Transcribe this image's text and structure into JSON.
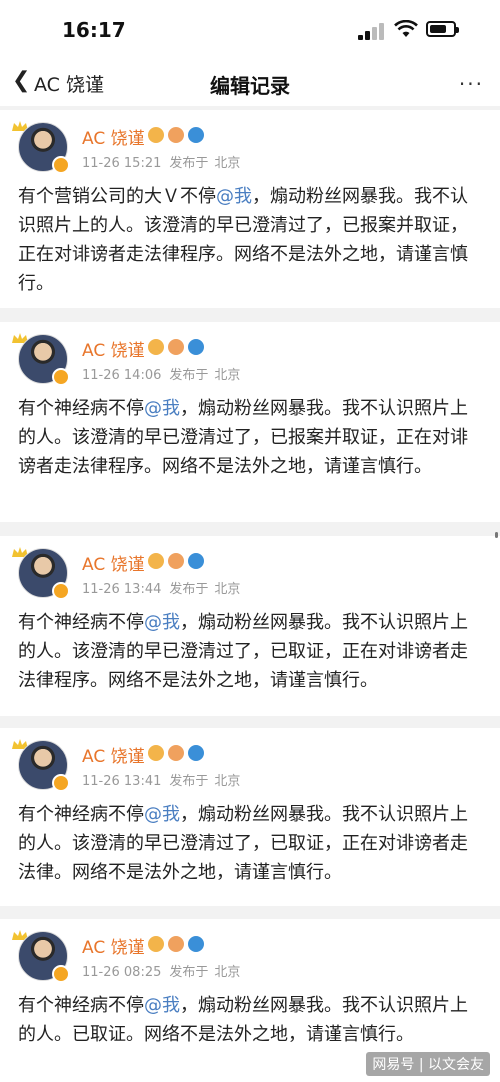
{
  "status_bar": {
    "time": "16:17"
  },
  "nav": {
    "back_label": "AC 饶谨",
    "title": "编辑记录",
    "more": "···"
  },
  "posts": [
    {
      "user": "AC 饶谨",
      "time": "11-26 15:21",
      "source": "发布于",
      "location": "北京",
      "pre": "有个营销公司的大Ｖ不停",
      "mention": "@我",
      "post": "，煽动粉丝网暴我。我不认识照片上的人。该澄清的早已澄清过了，已报案并取证，正在对诽谤者走法律程序。网络不是法外之地，请谨言慎行。"
    },
    {
      "user": "AC 饶谨",
      "time": "11-26 14:06",
      "source": "发布于",
      "location": "北京",
      "pre": "有个神经病不停",
      "mention": "@我",
      "post": "，煽动粉丝网暴我。我不认识照片上的人。该澄清的早已澄清过了，已报案并取证，正在对诽谤者走法律程序。网络不是法外之地，请谨言慎行。"
    },
    {
      "user": "AC 饶谨",
      "time": "11-26 13:44",
      "source": "发布于",
      "location": "北京",
      "pre": "有个神经病不停",
      "mention": "@我",
      "post": "，煽动粉丝网暴我。我不认识照片上的人。该澄清的早已澄清过了，已取证，正在对诽谤者走法律程序。网络不是法外之地，请谨言慎行。"
    },
    {
      "user": "AC 饶谨",
      "time": "11-26 13:41",
      "source": "发布于",
      "location": "北京",
      "pre": "有个神经病不停",
      "mention": "@我",
      "post": "，煽动粉丝网暴我。我不认识照片上的人。该澄清的早已澄清过了，已取证，正在对诽谤者走法律。网络不是法外之地，请谨言慎行。"
    },
    {
      "user": "AC 饶谨",
      "time": "11-26 08:25",
      "source": "发布于",
      "location": "北京",
      "pre": "有个神经病不停",
      "mention": "@我",
      "post": "，煽动粉丝网暴我。我不认识照片上的人。已取证。网络不是法外之地，请谨言慎行。"
    }
  ],
  "watermark": "网易号 | 以文会友",
  "colors": {
    "username": "#e8762c",
    "mention": "#4a7ec1",
    "meta": "#999999"
  }
}
